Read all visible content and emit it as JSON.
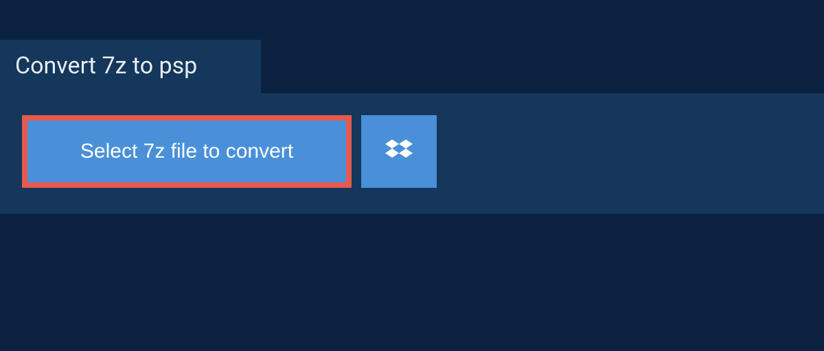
{
  "tab": {
    "title": "Convert 7z to psp"
  },
  "actions": {
    "select_file_label": "Select 7z file to convert"
  },
  "colors": {
    "background_dark": "#0a2240",
    "panel": "#14375b",
    "button_primary": "#4a90d9",
    "highlight_border": "#e55a4f",
    "text_light": "#e8edf2"
  }
}
